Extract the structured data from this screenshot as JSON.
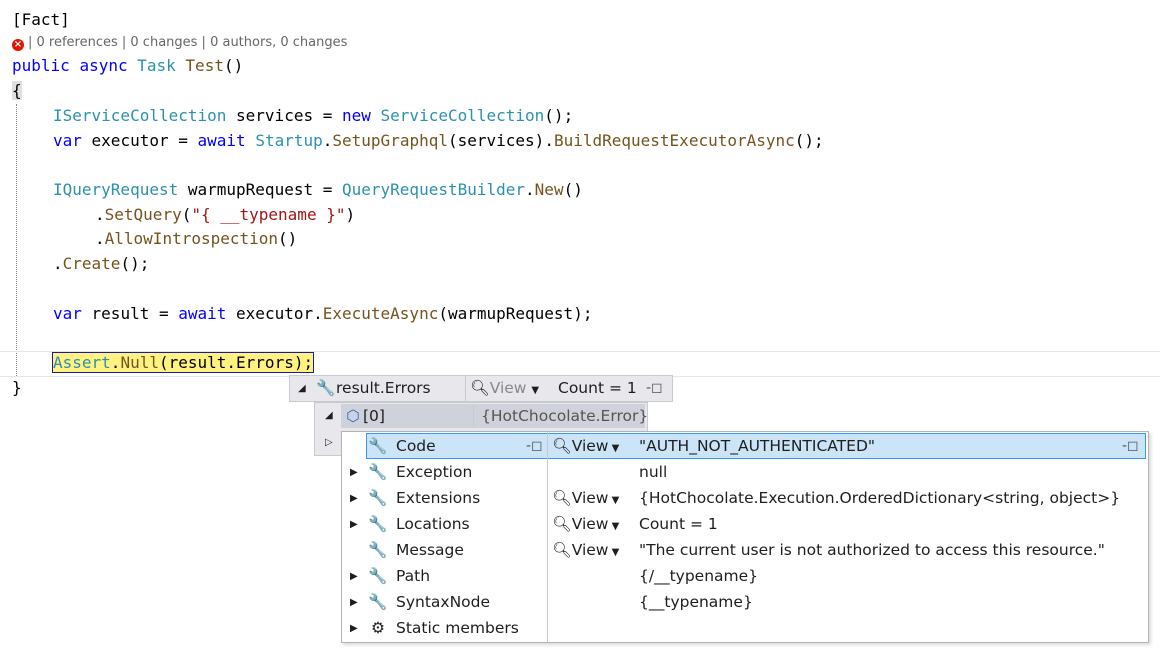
{
  "code": {
    "attribute": "[Fact]",
    "codelens": "| 0 references | 0 changes | 0 authors, 0 changes",
    "signature": {
      "public": "public",
      "async": "async",
      "task": "Task",
      "name": "Test",
      "parens": "()"
    },
    "open_brace": "{",
    "close_brace": "}",
    "line1": {
      "type": "IServiceCollection",
      "var": " services = ",
      "new": "new",
      "ctor": "ServiceCollection",
      "end": "();"
    },
    "line2": {
      "var_kw": "var",
      "a": " executor = ",
      "await": "await",
      "cls": "Startup",
      "dot": ".",
      "m1": "SetupGraphql",
      "p": "(services).",
      "m2": "BuildRequestExecutorAsync",
      "end": "();"
    },
    "line3": {
      "type": "IQueryRequest",
      "a": " warmupRequest = ",
      "cls": "QueryRequestBuilder",
      "dot": ".",
      "m": "New",
      "end": "()"
    },
    "line4": {
      "dot": ".",
      "m": "SetQuery",
      "open": "(",
      "str": "\"{ __typename }\"",
      "close": ")"
    },
    "line5": {
      "dot": ".",
      "m": "AllowIntrospection",
      "end": "()"
    },
    "line6": {
      "dot": ".",
      "m": "Create",
      "end": "();"
    },
    "line7": {
      "var_kw": "var",
      "a": " result = ",
      "await": "await",
      "b": " executor.",
      "m": "ExecuteAsync",
      "c": "(warmupRequest);"
    },
    "line8": {
      "cls": "Assert",
      "dot": ".",
      "m": "Null",
      "c": "(result.Errors);"
    }
  },
  "datatip": {
    "root": {
      "name": "result.Errors",
      "view": "View",
      "value": "Count = 1"
    },
    "item": {
      "name": "[0]",
      "value": "{HotChocolate.Error}"
    },
    "rows": [
      {
        "name": "Code",
        "view": "View",
        "value": "\"AUTH_NOT_AUTHENTICATED\"",
        "expandable": false
      },
      {
        "name": "Exception",
        "view": "",
        "value": "null",
        "expandable": true
      },
      {
        "name": "Extensions",
        "view": "View",
        "value": "{HotChocolate.Execution.OrderedDictionary<string, object>}",
        "expandable": true
      },
      {
        "name": "Locations",
        "view": "View",
        "value": "Count = 1",
        "expandable": true
      },
      {
        "name": "Message",
        "view": "View",
        "value": "\"The current user is not authorized to access this resource.\"",
        "expandable": false
      },
      {
        "name": "Path",
        "view": "",
        "value": "{/__typename}",
        "expandable": true
      },
      {
        "name": "SyntaxNode",
        "view": "",
        "value": "{__typename}",
        "expandable": true
      },
      {
        "name": "Static members",
        "view": "",
        "value": "",
        "expandable": true
      }
    ]
  },
  "icons": {
    "error": "error-icon",
    "wrench": "wrench-icon",
    "magnifier": "magnifier-icon",
    "pin": "pin-icon",
    "object": "object-icon",
    "static": "static-members-icon"
  },
  "colors": {
    "keyword": "#0000ff",
    "type": "#2b91af",
    "method": "#74531f",
    "string": "#a31515",
    "current_statement": "#fff280",
    "error": "#e51400"
  }
}
